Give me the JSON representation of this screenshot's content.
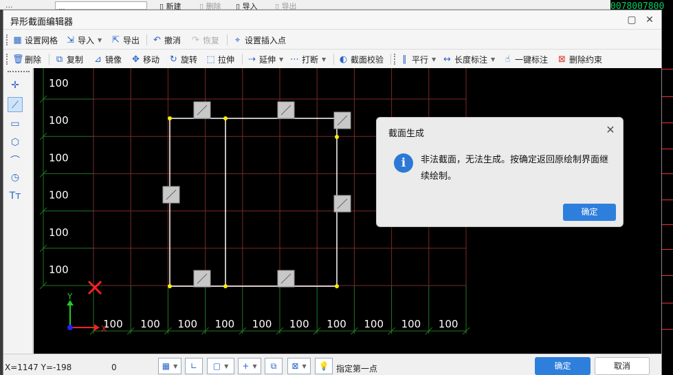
{
  "background": {
    "toolbar_label": "...",
    "field_value": "...",
    "new_label": "新建",
    "delete_label": "删除",
    "import_label": "导入",
    "export_label": "导出",
    "right_readout": "0078007800"
  },
  "window": {
    "title": "异形截面编辑器"
  },
  "toolbar1": {
    "grid": "设置网格",
    "import": "导入",
    "export": "导出",
    "undo": "撤消",
    "redo": "恢复",
    "insert_point": "设置插入点"
  },
  "toolbar2": {
    "delete": "删除",
    "copy": "复制",
    "mirror": "镜像",
    "move": "移动",
    "rotate": "旋转",
    "stretch": "拉伸",
    "extend": "延伸",
    "break": "打断",
    "check": "截面校验",
    "parallel": "平行",
    "length_dim": "长度标注",
    "one_click_dim": "一键标注",
    "delete_constraint": "删除约束"
  },
  "canvas": {
    "grid_label": "100",
    "axis_x": "X",
    "axis_y": "Y",
    "colors": {
      "grid_red": "#7a2a2a",
      "grid_green": "#1f7a1f",
      "outline": "#ffffff",
      "vertex": "#ffee00",
      "marker": "#ff2020"
    }
  },
  "status": {
    "coords": "X=1147 Y=-198",
    "value": "0",
    "prompt": "指定第一点",
    "ok": "确定",
    "cancel": "取消"
  },
  "dialog": {
    "title": "截面生成",
    "message": "非法截面，无法生成。按确定返回原绘制界面继续绘制。",
    "ok": "确定"
  }
}
